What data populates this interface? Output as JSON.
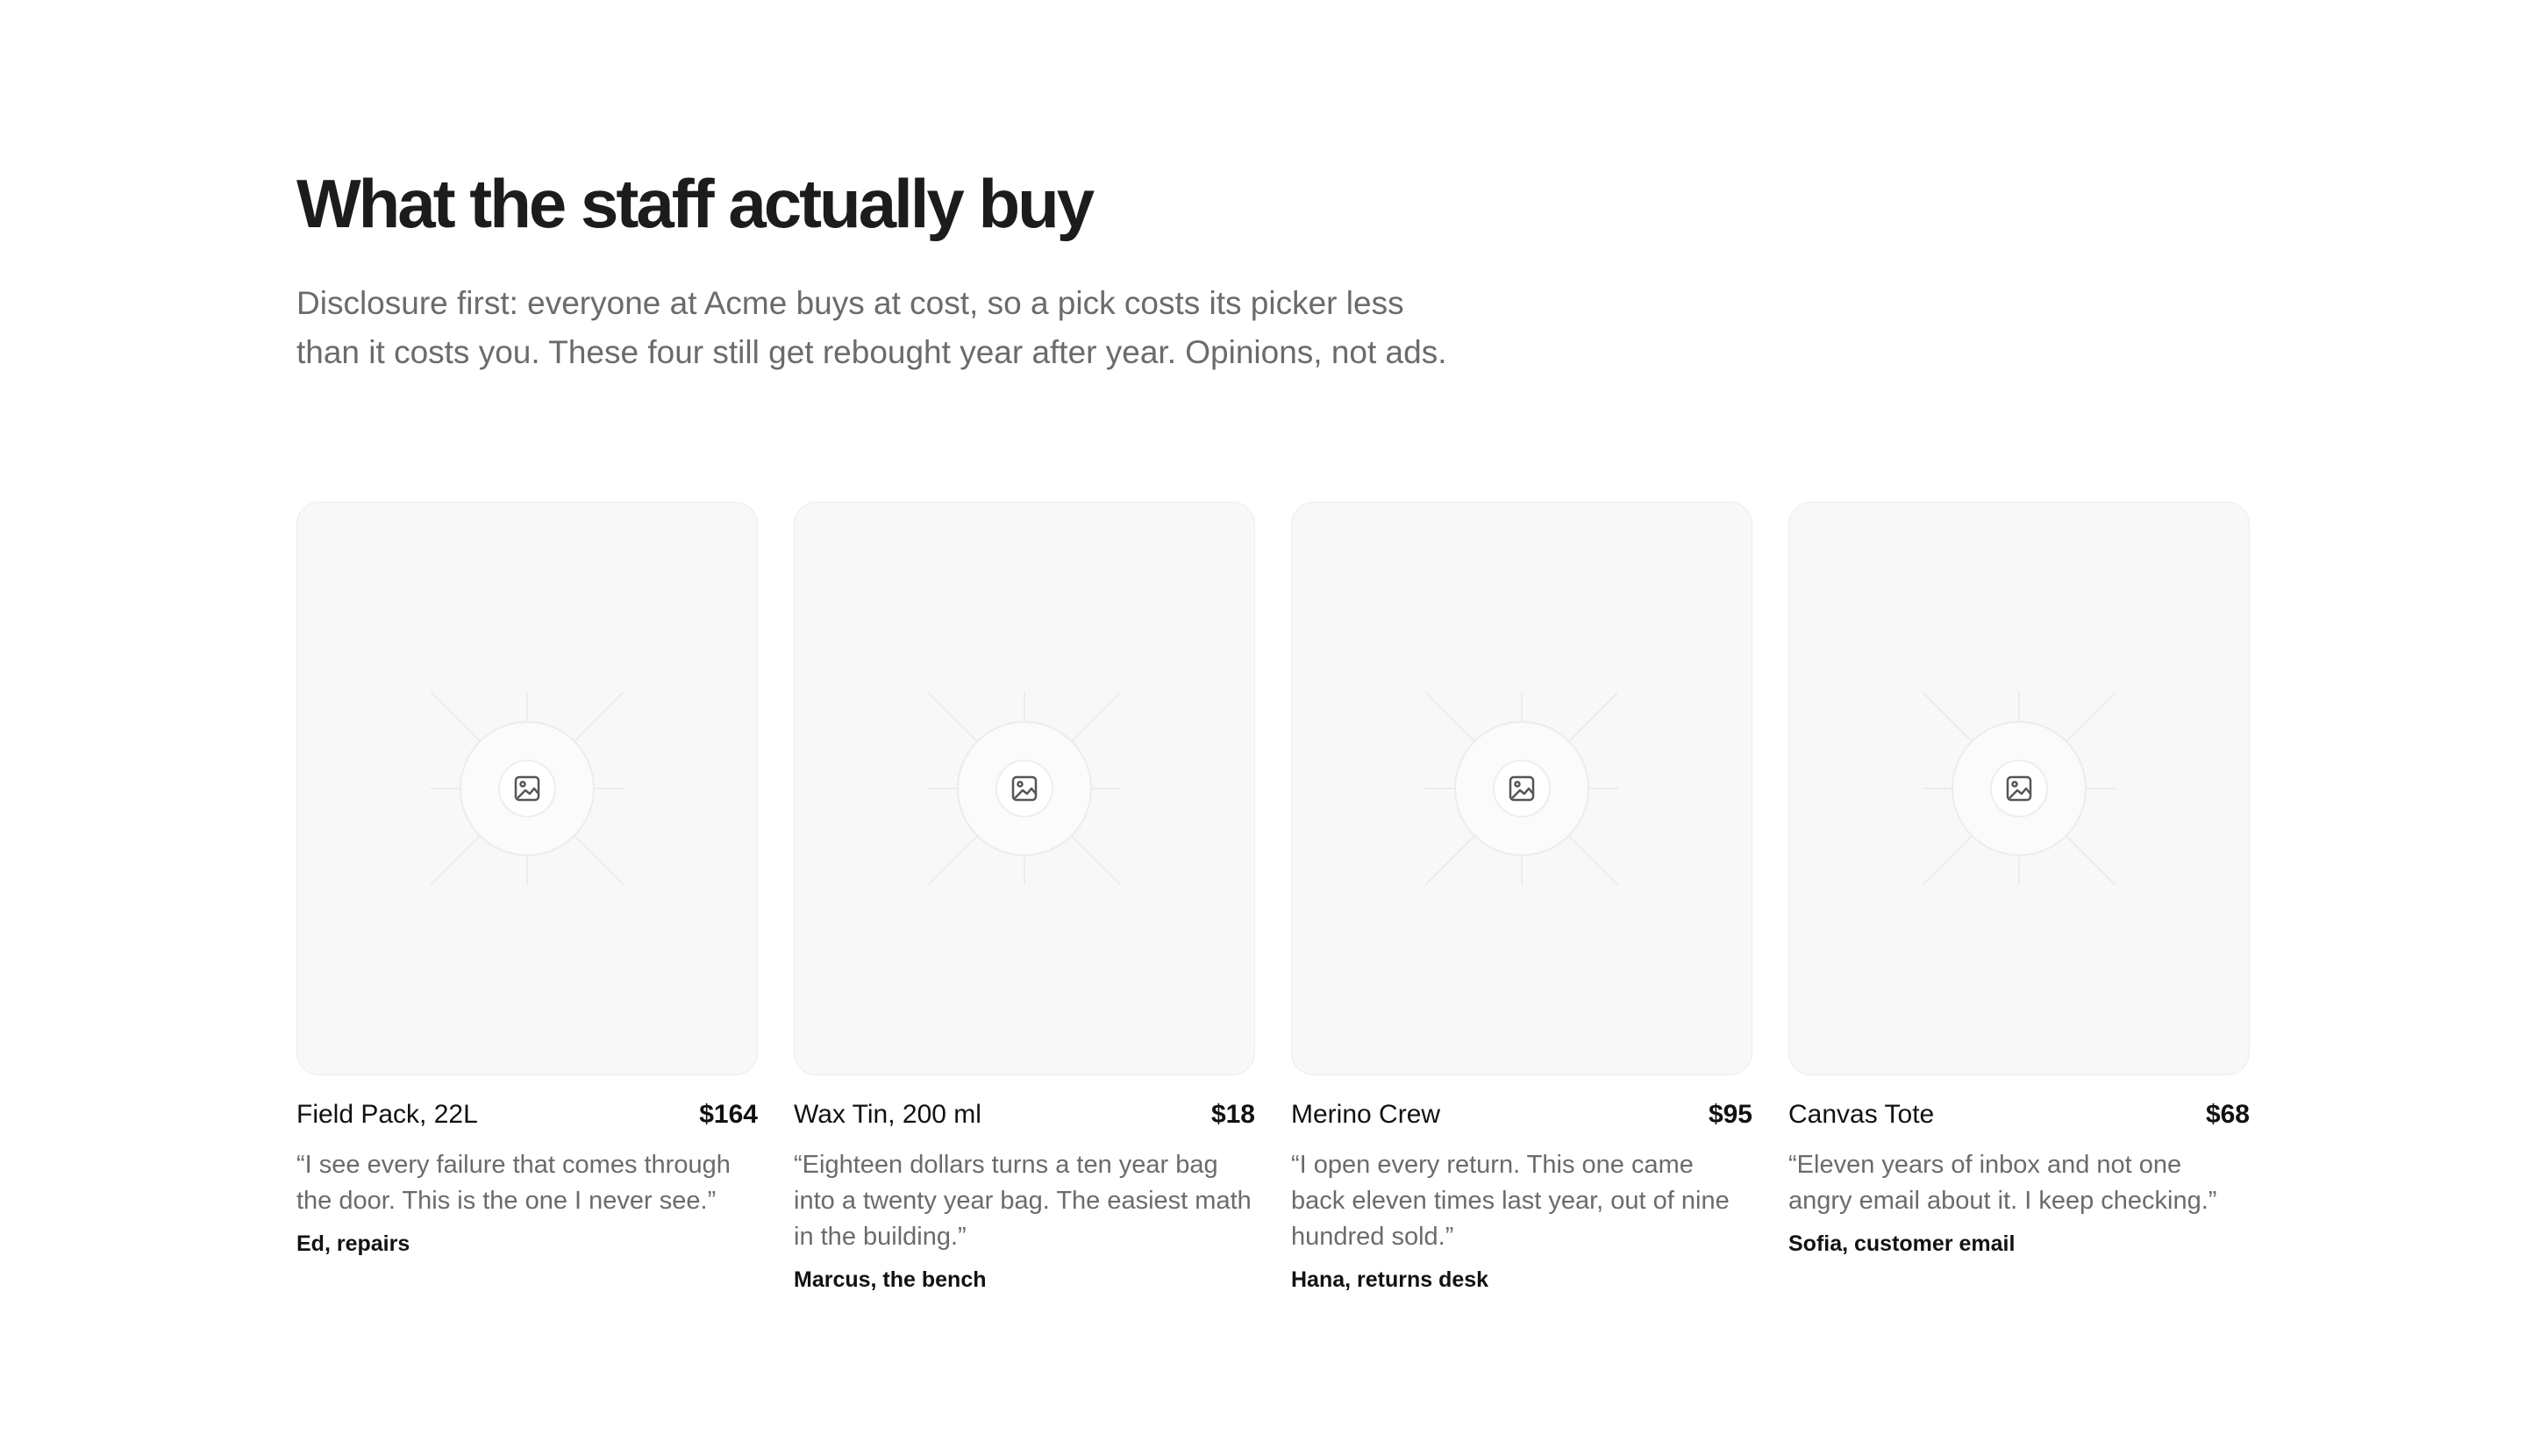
{
  "section": {
    "title": "What the staff actually buy",
    "intro": "Disclosure first: everyone at Acme buys at cost, so a pick costs its picker less than it costs you. These four still get rebought year after year. Opinions, not ads."
  },
  "colors": {
    "text": "#161616",
    "muted": "#6b6b6b",
    "card_background": "#f8f8f8",
    "card_border": "#ececec"
  },
  "products": [
    {
      "name": "Field Pack, 22L",
      "price": "$164",
      "quote": "“I see every failure that comes through the door. This is the one I never see.”",
      "attribution": "Ed, repairs",
      "icon": "image-icon"
    },
    {
      "name": "Wax Tin, 200 ml",
      "price": "$18",
      "quote": "“Eighteen dollars turns a ten year bag into a twenty year bag. The easiest math in the building.”",
      "attribution": "Marcus, the bench",
      "icon": "image-icon"
    },
    {
      "name": "Merino Crew",
      "price": "$95",
      "quote": "“I open every return. This one came back eleven times last year, out of nine hundred sold.”",
      "attribution": "Hana, returns desk",
      "icon": "image-icon"
    },
    {
      "name": "Canvas Tote",
      "price": "$68",
      "quote": "“Eleven years of inbox and not one angry email about it. I keep checking.”",
      "attribution": "Sofia, customer email",
      "icon": "image-icon"
    }
  ]
}
